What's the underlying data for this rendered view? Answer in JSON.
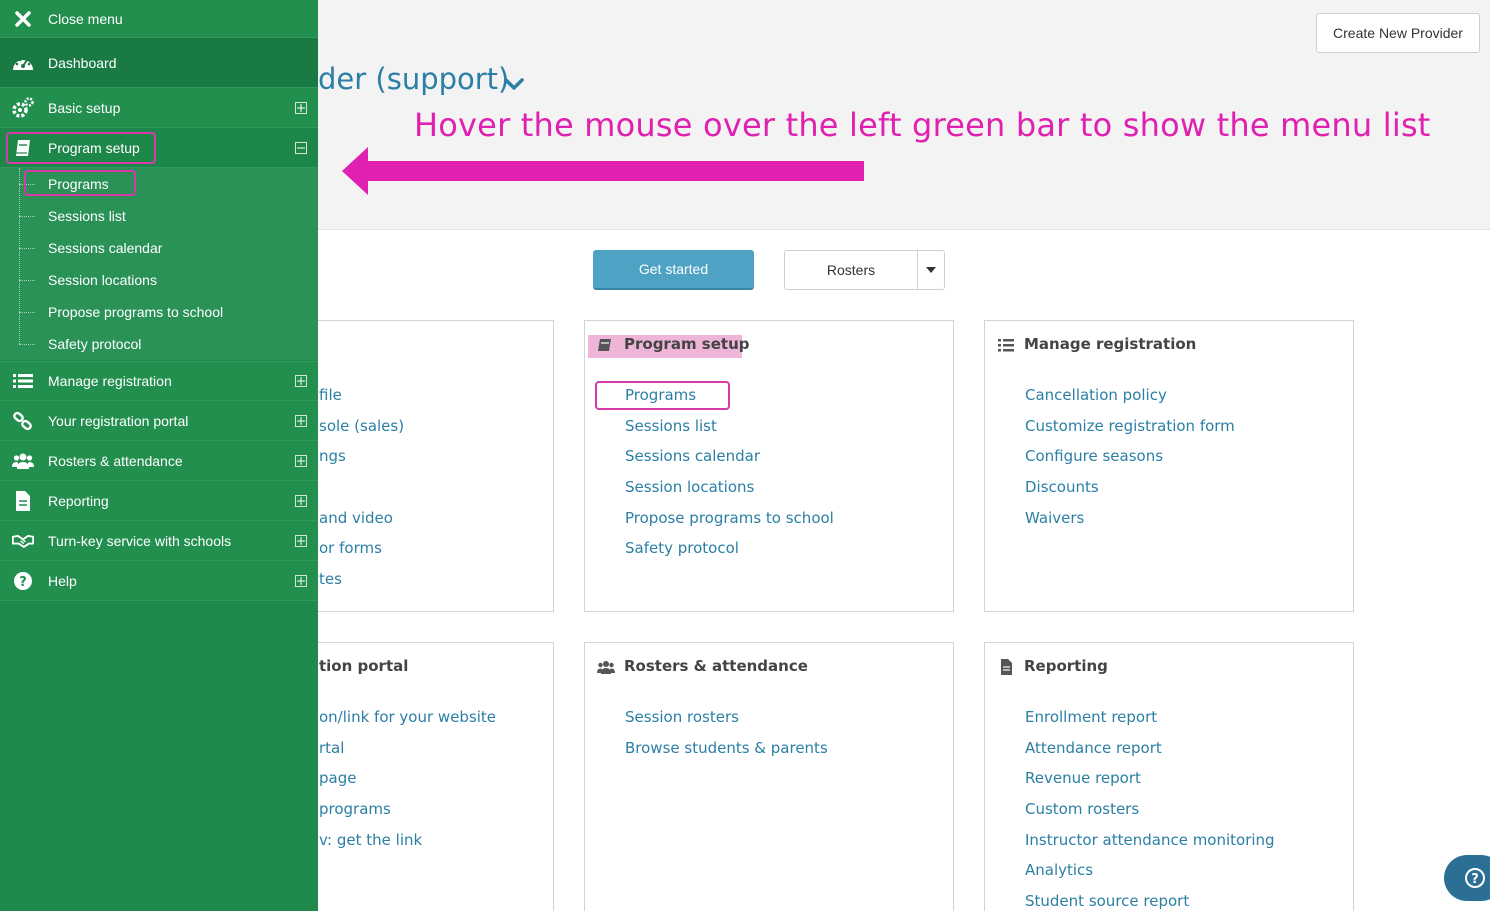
{
  "header": {
    "title": "der (support)",
    "create_button": "Create New Provider"
  },
  "annotation": {
    "text": "Hover the mouse over the left green bar to show the menu list",
    "color": "#e020b0"
  },
  "actions": {
    "get_started": "Get started",
    "rosters": "Rosters"
  },
  "cards": {
    "c1": {
      "links": [
        "file",
        "sole (sales)",
        "ngs",
        "",
        "and video",
        "or forms",
        "tes"
      ]
    },
    "c2": {
      "title": "Program setup",
      "icon": "book-icon",
      "links": [
        "Programs",
        "Sessions list",
        "Sessions calendar",
        "Session locations",
        "Propose programs to school",
        "Safety protocol"
      ]
    },
    "c3": {
      "title": "Manage registration",
      "icon": "list-icon",
      "links": [
        "Cancellation policy",
        "Customize registration form",
        "Configure seasons",
        "Discounts",
        "Waivers"
      ]
    },
    "c4": {
      "title": "tion portal",
      "links": [
        "on/link for your website",
        "rtal",
        "page",
        "programs",
        "v: get the link"
      ]
    },
    "c5": {
      "title": "Rosters & attendance",
      "icon": "users-icon",
      "links": [
        "Session rosters",
        "Browse students & parents"
      ]
    },
    "c6": {
      "title": "Reporting",
      "icon": "document-icon",
      "links": [
        "Enrollment report",
        "Attendance report",
        "Revenue report",
        "Custom rosters",
        "Instructor attendance monitoring",
        "Analytics",
        "Student source report"
      ]
    }
  },
  "sidebar": {
    "close": "Close menu",
    "dashboard": "Dashboard",
    "basic_setup": "Basic setup",
    "program_setup": "Program setup",
    "sub": [
      "Programs",
      "Sessions list",
      "Sessions calendar",
      "Session locations",
      "Propose programs to school",
      "Safety protocol"
    ],
    "manage_registration": "Manage registration",
    "registration_portal": "Your registration portal",
    "rosters_attendance": "Rosters & attendance",
    "reporting": "Reporting",
    "turnkey": "Turn-key service with schools",
    "help": "Help"
  },
  "colors": {
    "sidebar": "#1f8a4c",
    "link": "#2b7fa5",
    "primary_button": "#4ea3c4",
    "highlight": "#d63aa8"
  }
}
